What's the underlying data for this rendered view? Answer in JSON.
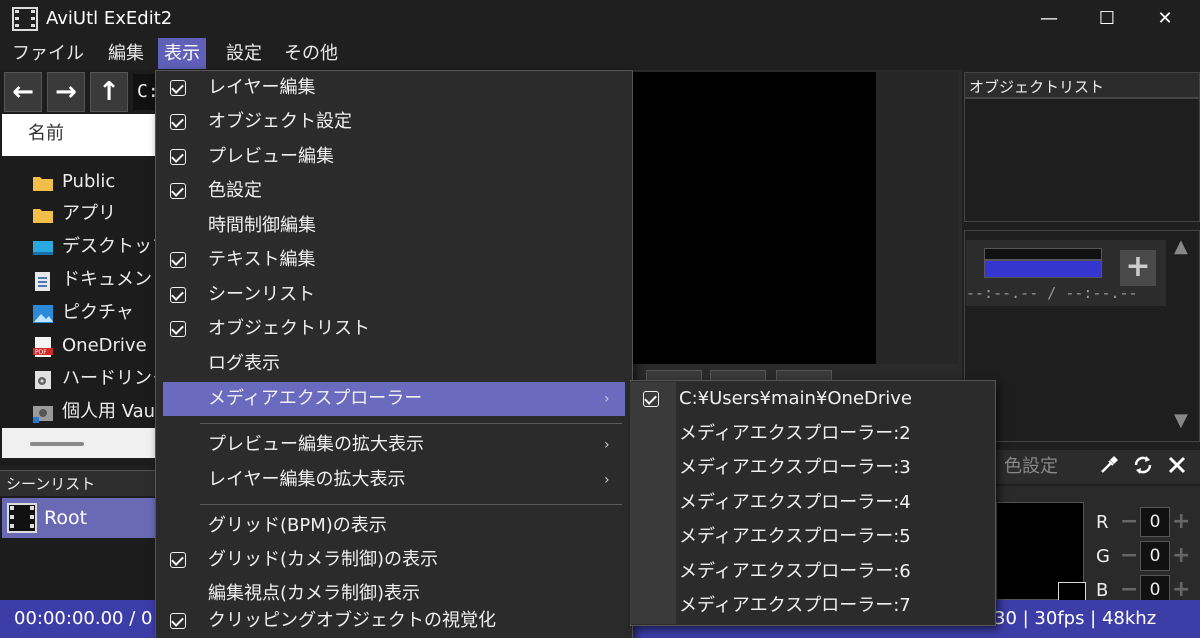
{
  "window": {
    "title": "AviUtl ExEdit2",
    "minimize": "—",
    "maximize": "☐",
    "close": "✕"
  },
  "menubar": {
    "file": "ファイル",
    "edit": "編集",
    "view": "表示",
    "settings": "設定",
    "other": "その他"
  },
  "explorer": {
    "back": "←",
    "forward": "→",
    "up": "↑",
    "path": "C:",
    "name_header": "名前",
    "items": [
      {
        "label": "Public",
        "icon": "folder-icon"
      },
      {
        "label": "アプリ",
        "icon": "folder-icon"
      },
      {
        "label": "デスクトップ",
        "icon": "desktop-icon"
      },
      {
        "label": "ドキュメント",
        "icon": "document-icon"
      },
      {
        "label": "ピクチャ",
        "icon": "picture-icon"
      },
      {
        "label": "OneDrive",
        "icon": "pdf-icon"
      },
      {
        "label": "ハードリンク",
        "icon": "settings-file-icon"
      },
      {
        "label": "個人用 Vault",
        "icon": "vault-icon"
      }
    ]
  },
  "scene_list": {
    "header": "シーンリスト",
    "root": "Root"
  },
  "status": {
    "time": "00:00:00.00 / 0",
    "right": "30 | 30fps | 48khz"
  },
  "object_list": {
    "header": "オブジェクトリスト"
  },
  "media": {
    "time": "--:--.-- / --:--.--",
    "add": "+"
  },
  "color": {
    "title": "色設定",
    "channels": [
      {
        "label": "R",
        "value": "0"
      },
      {
        "label": "G",
        "value": "0"
      },
      {
        "label": "B",
        "value": "0"
      }
    ]
  },
  "view_menu": {
    "items": [
      {
        "label": "レイヤー編集",
        "checked": true
      },
      {
        "label": "オブジェクト設定",
        "checked": true
      },
      {
        "label": "プレビュー編集",
        "checked": true
      },
      {
        "label": "色設定",
        "checked": true
      },
      {
        "label": "時間制御編集",
        "checked": false
      },
      {
        "label": "テキスト編集",
        "checked": true
      },
      {
        "label": "シーンリスト",
        "checked": true
      },
      {
        "label": "オブジェクトリスト",
        "checked": true
      },
      {
        "label": "ログ表示",
        "checked": false
      },
      {
        "label": "メディアエクスプローラー",
        "checked": false,
        "submenu": true,
        "highlighted": true
      },
      {
        "label": "プレビュー編集の拡大表示",
        "checked": false,
        "submenu": true
      },
      {
        "label": "レイヤー編集の拡大表示",
        "checked": false,
        "submenu": true
      },
      {
        "label": "グリッド(BPM)の表示",
        "checked": false
      },
      {
        "label": "グリッド(カメラ制御)の表示",
        "checked": true
      },
      {
        "label": "編集視点(カメラ制御)表示",
        "checked": false
      },
      {
        "label": "クリッピングオブジェクトの視覚化",
        "checked": true
      }
    ],
    "arrow": "›"
  },
  "media_submenu": {
    "items": [
      {
        "label": "C:¥Users¥main¥OneDrive",
        "checked": true
      },
      {
        "label": "メディアエクスプローラー:2",
        "checked": false
      },
      {
        "label": "メディアエクスプローラー:3",
        "checked": false
      },
      {
        "label": "メディアエクスプローラー:4",
        "checked": false
      },
      {
        "label": "メディアエクスプローラー:5",
        "checked": false
      },
      {
        "label": "メディアエクスプローラー:6",
        "checked": false
      },
      {
        "label": "メディアエクスプローラー:7",
        "checked": false
      }
    ]
  },
  "colors": {
    "accent": "#6a6abf",
    "statusbar": "#3d3da8",
    "background": "#1f1f1f"
  }
}
